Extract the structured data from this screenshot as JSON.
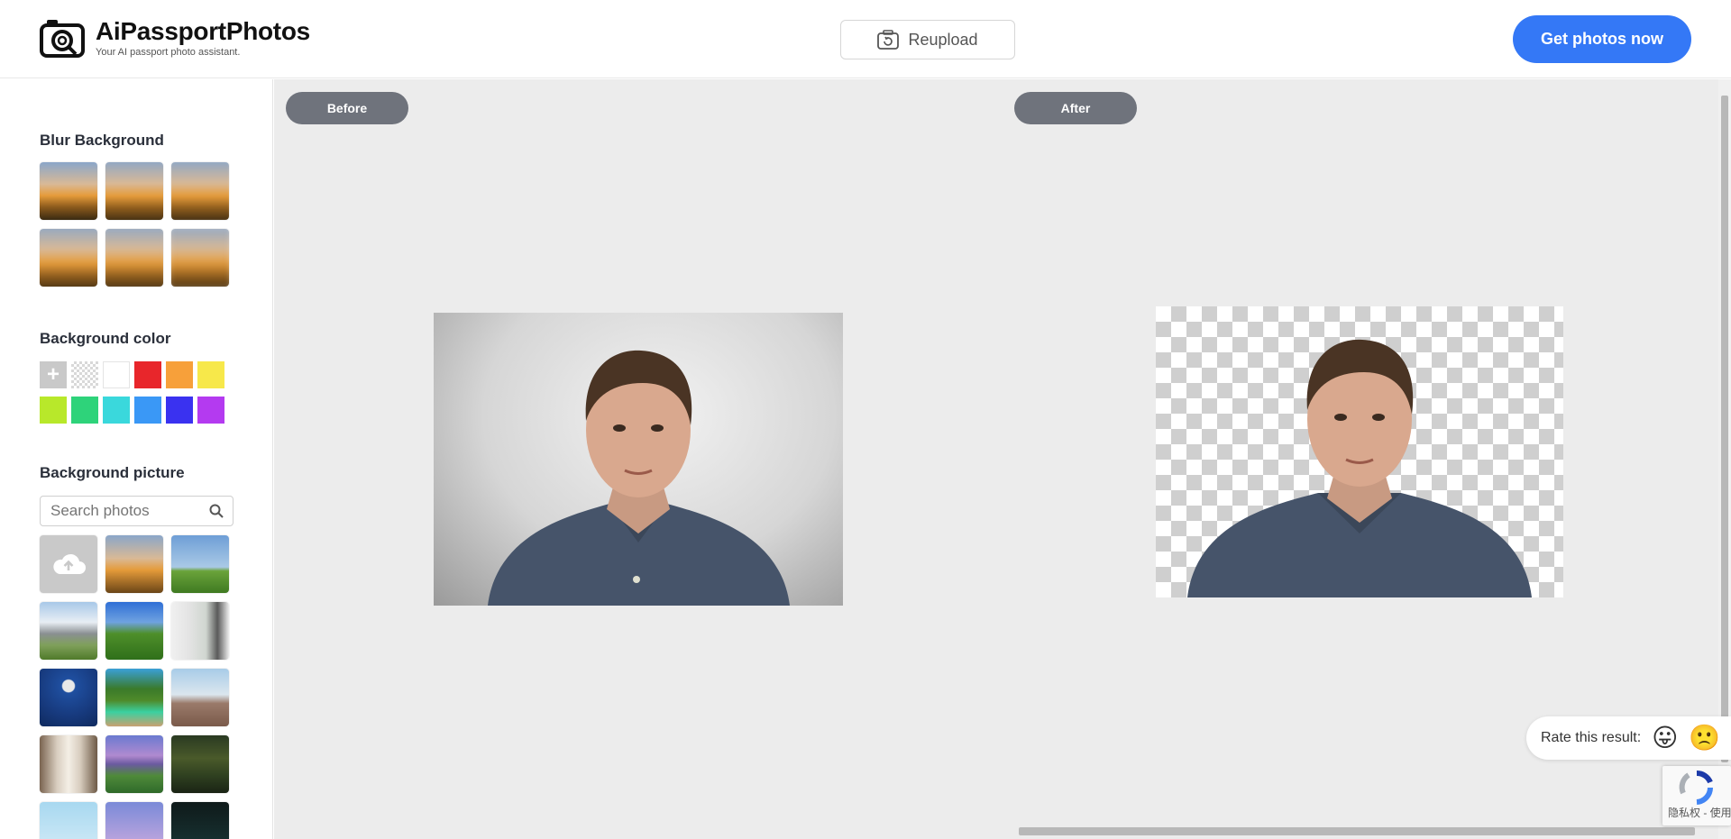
{
  "header": {
    "brand_title": "AiPassportPhotos",
    "brand_subtitle": "Your AI passport photo assistant.",
    "reupload_label": "Reupload",
    "get_photos_label": "Get photos now"
  },
  "sidebar": {
    "blur_title": "Blur Background",
    "blur_thumbs": [
      "blur-0",
      "blur-1",
      "blur-2",
      "blur-3",
      "blur-4",
      "blur-5"
    ],
    "color_title": "Background color",
    "colors": [
      "#e8e8e8",
      "transparent",
      "#ffffff",
      "#e8262b",
      "#f7a03a",
      "#f7e84a",
      "#b8e82a",
      "#2ed37a",
      "#3ad8dc",
      "#3a98f6",
      "#3a32f0",
      "#b43af0"
    ],
    "picture_title": "Background picture",
    "search_placeholder": "Search photos"
  },
  "workspace": {
    "before_label": "Before",
    "after_label": "After"
  },
  "rating": {
    "label": "Rate this result:"
  },
  "recaptcha": {
    "text": "隐私权 - 使用条款"
  }
}
